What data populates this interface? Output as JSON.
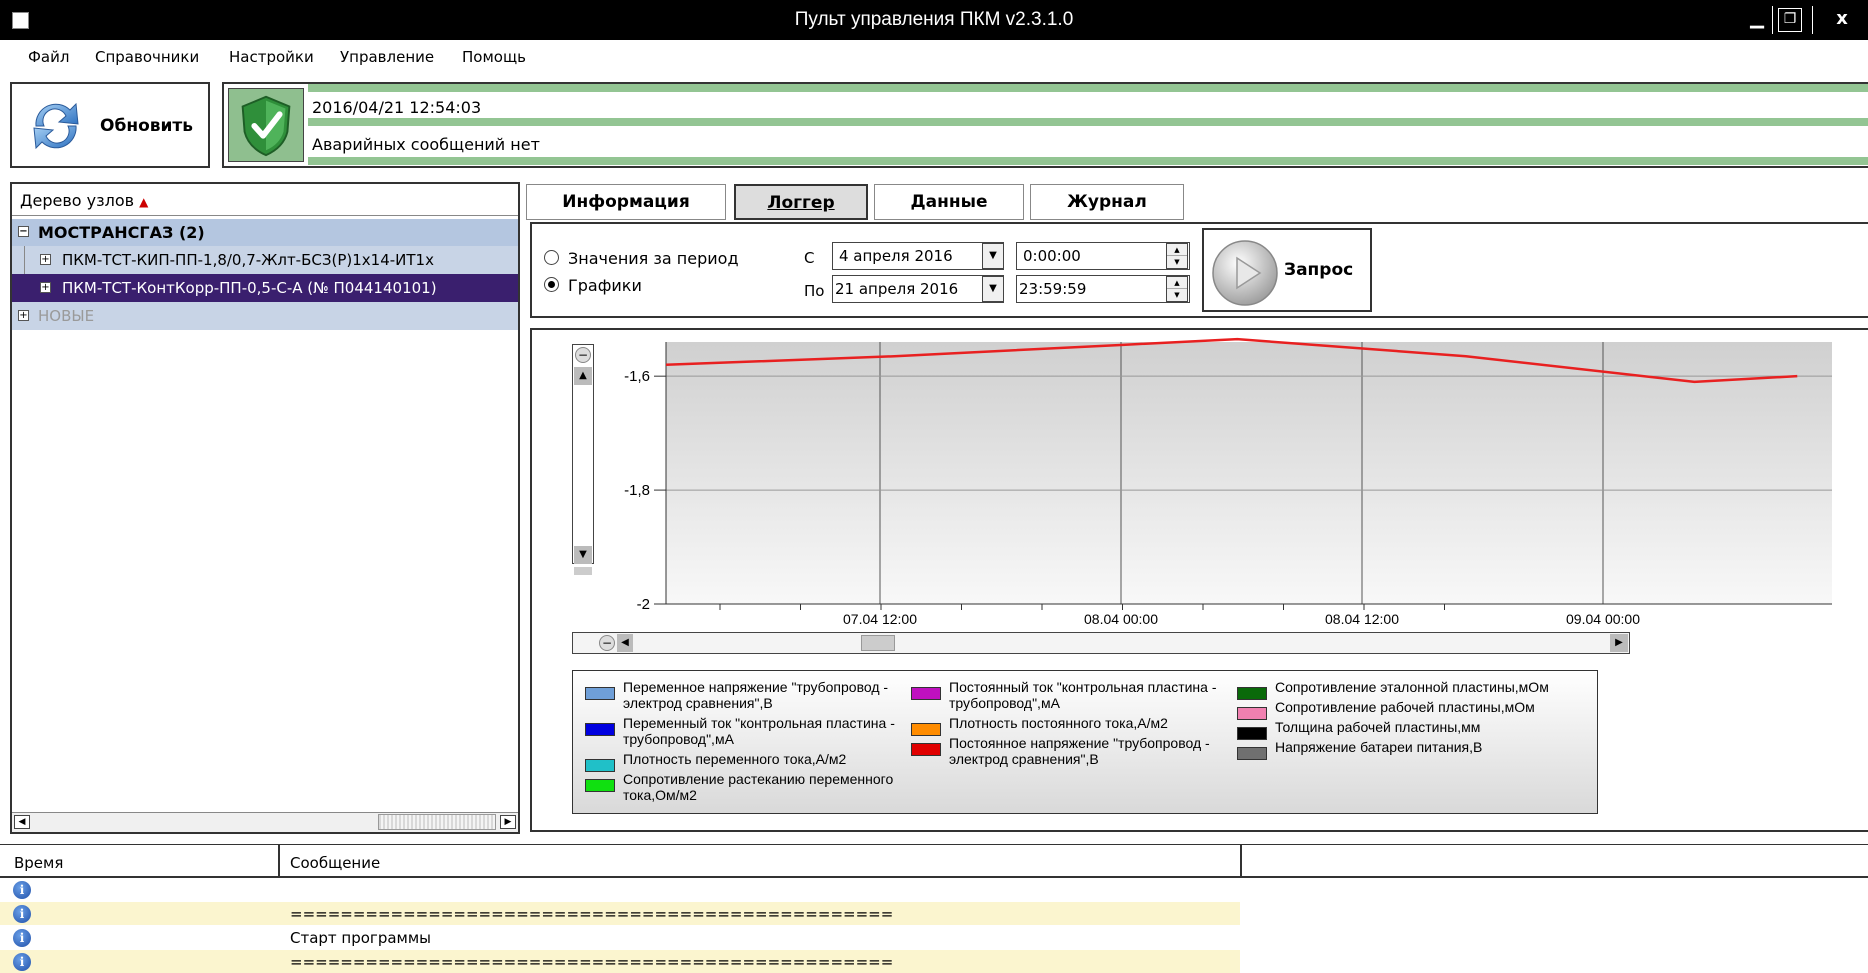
{
  "window": {
    "title": "Пульт управления ПКМ v2.3.1.0",
    "min": "▁",
    "max": "❐",
    "close": "x"
  },
  "menu": [
    "Файл",
    "Справочники",
    "Настройки",
    "Управление",
    "Помощь"
  ],
  "toolbar": {
    "refresh_label": "Обновить"
  },
  "status": {
    "timestamp": "2016/04/21 12:54:03",
    "message": "Аварийных сообщений нет",
    "indicator_color": "#93c593"
  },
  "tree": {
    "header": "Дерево узлов",
    "sort_icon": "▲",
    "items": [
      {
        "label": "МОСТРАНСГАЗ (2)",
        "expander": "−"
      },
      {
        "label": "ПКМ-ТСТ-КИП-ПП-1,8/0,7-Жлт-БСЗ(Р)1х14-ИТ1х",
        "expander": "+"
      },
      {
        "label": "ПКМ-ТСТ-КонтКорр-ПП-0,5-С-А (№ П044140101)",
        "expander": "+"
      },
      {
        "label": "НОВЫЕ",
        "expander": "+"
      }
    ],
    "selected_color": "#3a1f6e"
  },
  "tabs": [
    "Информация",
    "Логгер",
    "Данные",
    "Журнал"
  ],
  "filter": {
    "option_period": "Значения за период",
    "option_charts": "Графики",
    "from_label": "С",
    "to_label": "По",
    "from_date": "4   апреля   2016",
    "to_date": "21   апреля   2016",
    "from_time": "0:00:00",
    "to_time": "23:59:59",
    "query_label": "Запрос"
  },
  "chart_data": {
    "type": "line",
    "title": "",
    "xlabel": "",
    "ylabel": "",
    "x_ticks": [
      "07.04 12:00",
      "08.04 00:00",
      "08.04 12:00",
      "09.04 00:00"
    ],
    "y_ticks": [
      "-1,6",
      "-1,8",
      "-2"
    ],
    "ylim": [
      -2.0,
      -1.54
    ],
    "grid": true,
    "series": [
      {
        "color": "#e82020",
        "x": [
          0,
          0.4,
          0.8,
          1.0,
          1.4,
          1.8,
          1.98
        ],
        "y": [
          -1.58,
          -1.565,
          -1.545,
          -1.535,
          -1.565,
          -1.61,
          -1.6
        ]
      }
    ]
  },
  "legend": [
    {
      "label": "Переменное напряжение \"трубопровод - электрод сравнения\",В",
      "color": "#6f9fd8"
    },
    {
      "label": "Переменный ток \"контрольная пластина - трубопровод\",мА",
      "color": "#0000e0"
    },
    {
      "label": "Плотность переменного тока,А/м2",
      "color": "#20c0c8"
    },
    {
      "label": "Сопротивление растеканию переменного тока,Ом/м2",
      "color": "#10e010"
    },
    {
      "label": "Постоянный ток \"контрольная пластина - трубопровод\",мА",
      "color": "#c010c0"
    },
    {
      "label": "Плотность постоянного тока,А/м2",
      "color": "#ff8c00"
    },
    {
      "label": "Постоянное напряжение \"трубопровод - электрод сравнения\",В",
      "color": "#e00000"
    },
    {
      "label": "Сопротивление эталонной пластины,мОм",
      "color": "#0a6a0a"
    },
    {
      "label": "Сопротивление рабочей пластины,мОм",
      "color": "#f080b0"
    },
    {
      "label": "Толщина рабочей пластины,мм",
      "color": "#000000"
    },
    {
      "label": "Напряжение батареи питания,В",
      "color": "#707070"
    }
  ],
  "log": {
    "col_time": "Время",
    "col_message": "Сообщение",
    "rows": [
      {
        "message": ""
      },
      {
        "message": "================================================"
      },
      {
        "message": "Старт программы"
      },
      {
        "message": "================================================"
      }
    ],
    "highlight_color": "#fbf5cf"
  }
}
